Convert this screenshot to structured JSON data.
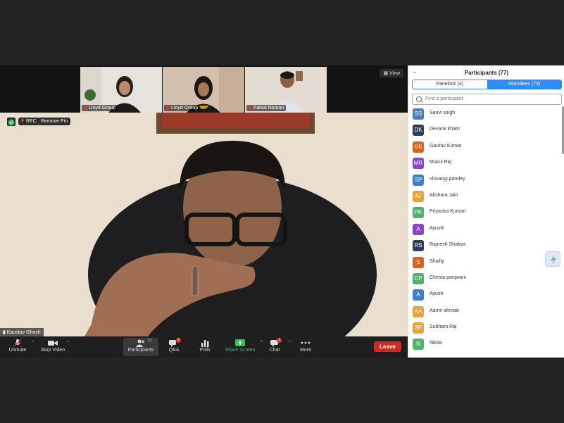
{
  "thumbnails": [
    {
      "label": "Lloyd Group"
    },
    {
      "label": "Lloyd Group"
    },
    {
      "label": "Faisal Noman"
    }
  ],
  "view_label": "View",
  "main_video": {
    "speaker": "Kaustav Ghosh",
    "rec_label": "REC",
    "remove_pin_label": "Remove Pin"
  },
  "toolbar": {
    "unmute": "Unmute",
    "stop_video": "Stop Video",
    "participants": "Participants",
    "participants_count": "77",
    "qa": "Q&A",
    "qa_badge": "1",
    "polls": "Polls",
    "share_screen": "Share Screen",
    "chat": "Chat",
    "chat_badge": "1",
    "more": "More",
    "leave": "Leave"
  },
  "panel": {
    "title": "Participants (77)",
    "tabs": [
      "Panelists (4)",
      "Attendees (73)"
    ],
    "search_placeholder": "Find a participant",
    "attendees": [
      {
        "initials": "SS",
        "name": "Sanvi singh",
        "color": "#4a7fc1"
      },
      {
        "initials": "DK",
        "name": "Devank khatri",
        "color": "#2f3e56"
      },
      {
        "initials": "GK",
        "name": "Gaurav Kumar",
        "color": "#d9631f"
      },
      {
        "initials": "MR",
        "name": "Mukul Raj",
        "color": "#8b44c6"
      },
      {
        "initials": "SP",
        "name": "shivangi pandey",
        "color": "#3c7fd0"
      },
      {
        "initials": "AJ",
        "name": "Akshara Jain",
        "color": "#e9a23b"
      },
      {
        "initials": "PK",
        "name": "Priyanka Kumari",
        "color": "#4fb36b"
      },
      {
        "initials": "A",
        "name": "Ayushi",
        "color": "#8b44c6"
      },
      {
        "initials": "RS",
        "name": "Rajnesh Shakya",
        "color": "#2f3e56"
      },
      {
        "initials": "S",
        "name": "Shailly",
        "color": "#d9631f"
      },
      {
        "initials": "CP",
        "name": "Chesta panjwani",
        "color": "#4fb36b"
      },
      {
        "initials": "A",
        "name": "Ayush",
        "color": "#3c7fd0"
      },
      {
        "initials": "AA",
        "name": "Aamir ahmad",
        "color": "#e9a23b"
      },
      {
        "initials": "SR",
        "name": "Subham Raj",
        "color": "#e9a23b"
      },
      {
        "initials": "N",
        "name": "Nikita",
        "color": "#4fb36b"
      }
    ]
  },
  "colors": {
    "accent": "#2d8cff",
    "leave": "#d9261c",
    "share": "#33c35b",
    "rec": "#e2342d"
  }
}
